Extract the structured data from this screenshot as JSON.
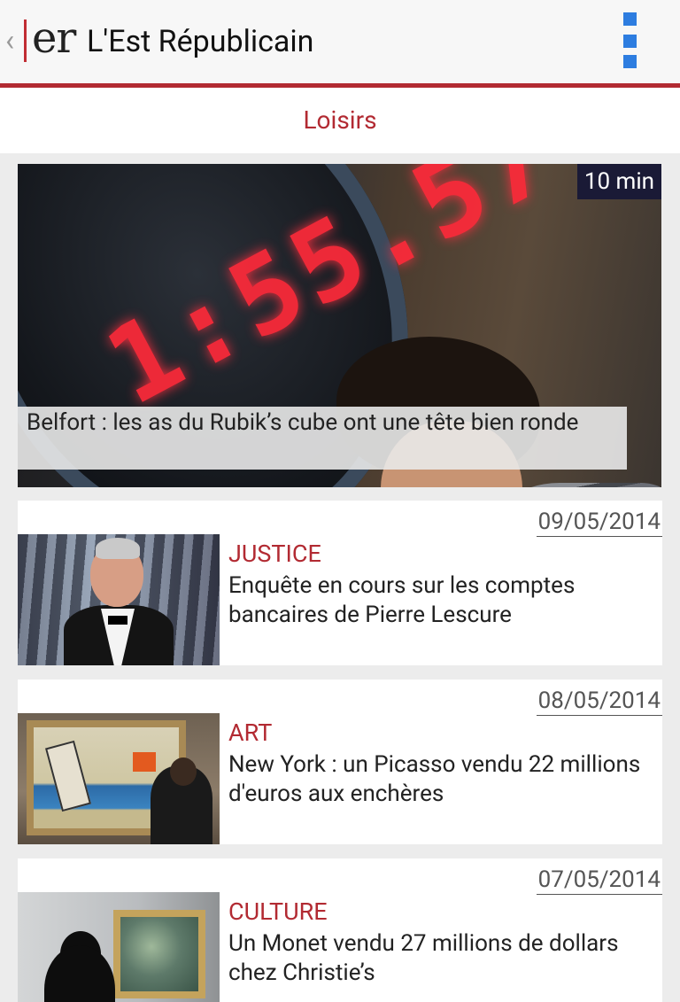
{
  "app": {
    "title": "L'Est Républicain",
    "logo_text": "er",
    "back_glyph": "‹",
    "accent_color": "#b22a32",
    "menu_icon": "overflow-menu-icon"
  },
  "section": {
    "title": "Loisirs"
  },
  "hero": {
    "time_badge": "10 min",
    "caption": "Belfort : les as du Rubik’s cube ont une tête bien ronde",
    "image_desc": "timer-and-boy-image"
  },
  "articles": [
    {
      "date": "09/05/2014",
      "category": "JUSTICE",
      "headline": "Enquête en cours sur les comptes bancaires de Pierre Lescure"
    },
    {
      "date": "08/05/2014",
      "category": "ART",
      "headline": "New York : un Picasso vendu 22 millions d'euros aux enchères"
    },
    {
      "date": "07/05/2014",
      "category": "CULTURE",
      "headline": "Un Monet vendu 27 millions de dollars chez Christie’s"
    }
  ]
}
